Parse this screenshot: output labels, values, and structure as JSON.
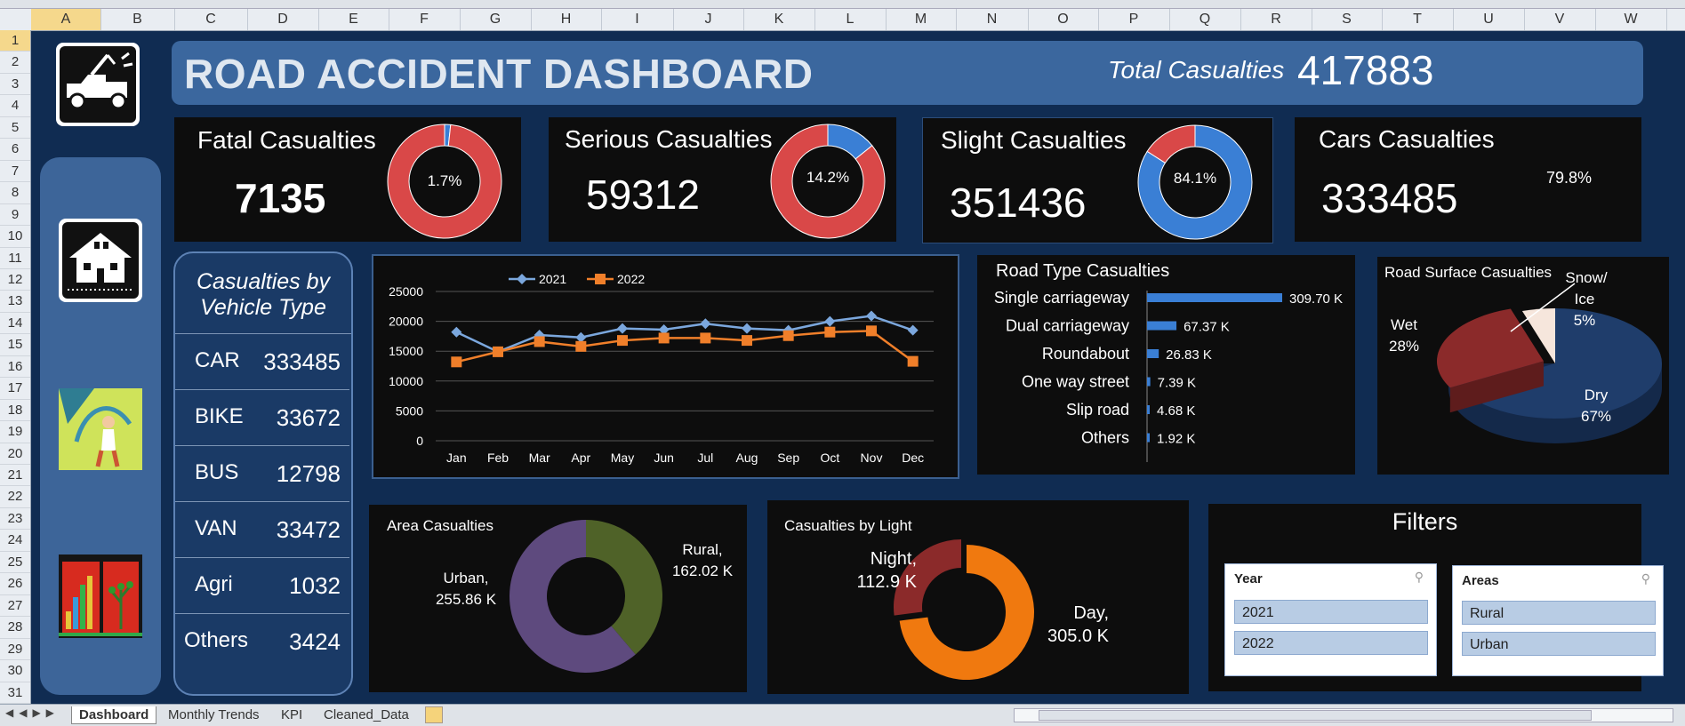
{
  "sheet": {
    "columns": [
      "A",
      "B",
      "C",
      "D",
      "E",
      "F",
      "G",
      "H",
      "I",
      "J",
      "K",
      "L",
      "M",
      "N",
      "O",
      "P",
      "Q",
      "R",
      "S",
      "T",
      "U",
      "V",
      "W"
    ],
    "rows": [
      "1",
      "2",
      "3",
      "4",
      "5",
      "6",
      "7",
      "8",
      "9",
      "10",
      "11",
      "12",
      "13",
      "14",
      "15",
      "16",
      "17",
      "18",
      "19",
      "20",
      "21",
      "22",
      "23",
      "24",
      "25",
      "26",
      "27",
      "28",
      "29",
      "30",
      "31"
    ],
    "tabs": [
      "Dashboard",
      "Monthly Trends",
      "KPI",
      "Cleaned_Data"
    ]
  },
  "header": {
    "title": "ROAD ACCIDENT DASHBOARD",
    "total_label": "Total Casualties",
    "total_value": "417883"
  },
  "kpis": [
    {
      "title": "Fatal Casualties",
      "value": "7135",
      "pct_label": "1.7%",
      "pct": 1.7
    },
    {
      "title": "Serious Casualties",
      "value": "59312",
      "pct_label": "14.2%",
      "pct": 14.2
    },
    {
      "title": "Slight Casualties",
      "value": "351436",
      "pct_label": "84.1%",
      "pct": 84.1
    },
    {
      "title": "Cars Casualties",
      "value": "333485",
      "pct_label": "79.8%"
    }
  ],
  "vehicle": {
    "title_line1": "Casualties by",
    "title_line2": "Vehicle Type",
    "rows": [
      {
        "name": "CAR",
        "value": "333485"
      },
      {
        "name": "BIKE",
        "value": "33672"
      },
      {
        "name": "BUS",
        "value": "12798"
      },
      {
        "name": "VAN",
        "value": "33472"
      },
      {
        "name": "Agri",
        "value": "1032"
      },
      {
        "name": "Others",
        "value": "3424"
      }
    ]
  },
  "colors": {
    "red": "#d94848",
    "blue": "#3a7fd5",
    "series2021": "#7ba7dd",
    "series2022": "#f07f2a",
    "green": "#4f6228",
    "purple": "#5e4a7e",
    "orange": "#f0790f",
    "darkred": "#8b2a2a",
    "navy": "#1f3d6b"
  },
  "filters": {
    "title": "Filters",
    "year_title": "Year",
    "year_items": [
      "2021",
      "2022"
    ],
    "area_title": "Areas",
    "area_items": [
      "Rural",
      "Urban"
    ]
  },
  "icons": [
    "tow-truck-icon",
    "house-icon",
    "road-worker-icon",
    "chart-tree-icon",
    "filter-clear-icon"
  ],
  "chart_data": [
    {
      "id": "monthly",
      "type": "line",
      "categories": [
        "Jan",
        "Feb",
        "Mar",
        "Apr",
        "May",
        "Jun",
        "Jul",
        "Aug",
        "Sep",
        "Oct",
        "Nov",
        "Dec"
      ],
      "series": [
        {
          "name": "2021",
          "values": [
            18200,
            14900,
            17700,
            17300,
            18800,
            18600,
            19600,
            18800,
            18500,
            20000,
            20900,
            18500
          ]
        },
        {
          "name": "2022",
          "values": [
            13200,
            14900,
            16600,
            15800,
            16800,
            17200,
            17200,
            16800,
            17600,
            18200,
            18400,
            13300
          ]
        }
      ],
      "yticks": [
        "25000",
        "20000",
        "15000",
        "10000",
        "5000",
        "0"
      ],
      "ylim": [
        0,
        25000
      ],
      "grid": true,
      "legend": "top"
    },
    {
      "id": "roadtype",
      "type": "bar",
      "title": "Road Type Casualties",
      "categories": [
        "Single carriageway",
        "Dual carriageway",
        "Roundabout",
        "One way street",
        "Slip road",
        "Others"
      ],
      "values": [
        309.7,
        67.37,
        26.83,
        7.39,
        4.68,
        1.92
      ],
      "labels": [
        "309.70 K",
        "67.37 K",
        "26.83 K",
        "7.39 K",
        "4.68 K",
        "1.92 K"
      ]
    },
    {
      "id": "surface",
      "type": "pie",
      "title": "Road Surface Casualties",
      "categories": [
        "Dry",
        "Wet",
        "Snow/ Ice"
      ],
      "values": [
        67,
        28,
        5
      ],
      "labels": [
        "Dry",
        "Wet",
        "Snow/"
      ],
      "label2": [
        "67%",
        "28%",
        "Ice"
      ],
      "label3": [
        "",
        "",
        "5%"
      ]
    },
    {
      "id": "area",
      "type": "pie",
      "title": "Area Casualties",
      "categories": [
        "Urban",
        "Rural"
      ],
      "values": [
        255.86,
        162.02
      ],
      "labels": [
        "Urban,",
        "Rural,"
      ],
      "values_text": [
        "255.86 K",
        "162.02 K"
      ]
    },
    {
      "id": "light",
      "type": "pie",
      "title": "Casualties by Light",
      "categories": [
        "Night",
        "Day"
      ],
      "values": [
        112.9,
        305.0
      ],
      "labels": [
        "Night,",
        "Day,"
      ],
      "values_text": [
        "112.9 K",
        "305.0 K"
      ]
    }
  ]
}
